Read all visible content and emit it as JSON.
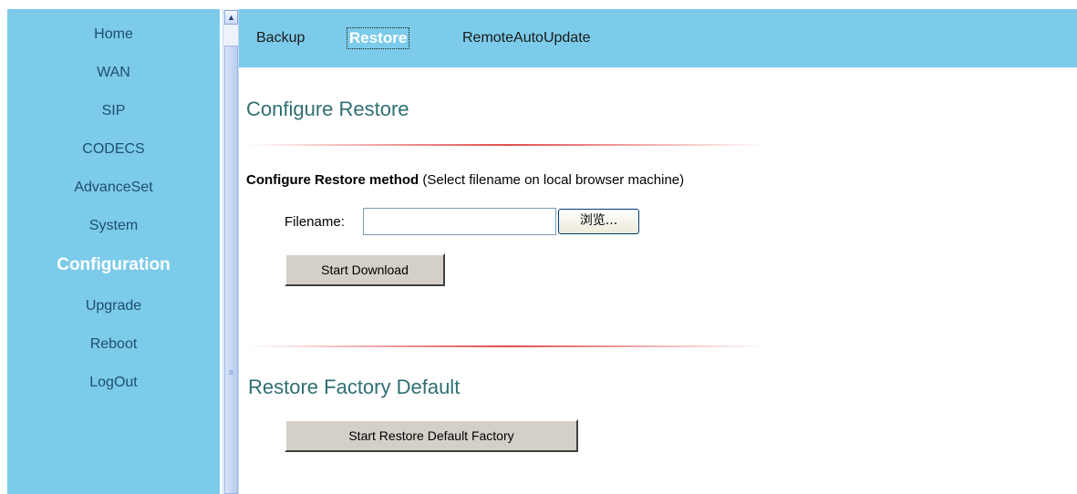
{
  "sidebar": {
    "items": [
      {
        "label": "Home"
      },
      {
        "label": "WAN"
      },
      {
        "label": "SIP"
      },
      {
        "label": "CODECS"
      },
      {
        "label": "AdvanceSet"
      },
      {
        "label": "System"
      },
      {
        "label": "Configuration",
        "active": true
      },
      {
        "label": "Upgrade"
      },
      {
        "label": "Reboot"
      },
      {
        "label": "LogOut"
      }
    ]
  },
  "tabs": [
    {
      "label": "Backup"
    },
    {
      "label": "Restore",
      "active": true
    },
    {
      "label": "RemoteAutoUpdate"
    }
  ],
  "configure_restore": {
    "title": "Configure Restore",
    "method_bold": "Configure Restore method",
    "method_note": " (Select filename on local browser machine)",
    "filename_label": "Filename:",
    "filename_value": "",
    "browse_label": "浏览...",
    "start_download_label": "Start Download"
  },
  "factory_default": {
    "title": "Restore Factory Default",
    "button_label": "Start Restore Default Factory"
  },
  "colors": {
    "nav_bg": "#7ccbea",
    "heading": "#2f6f72",
    "divider": "#e34c4c"
  }
}
